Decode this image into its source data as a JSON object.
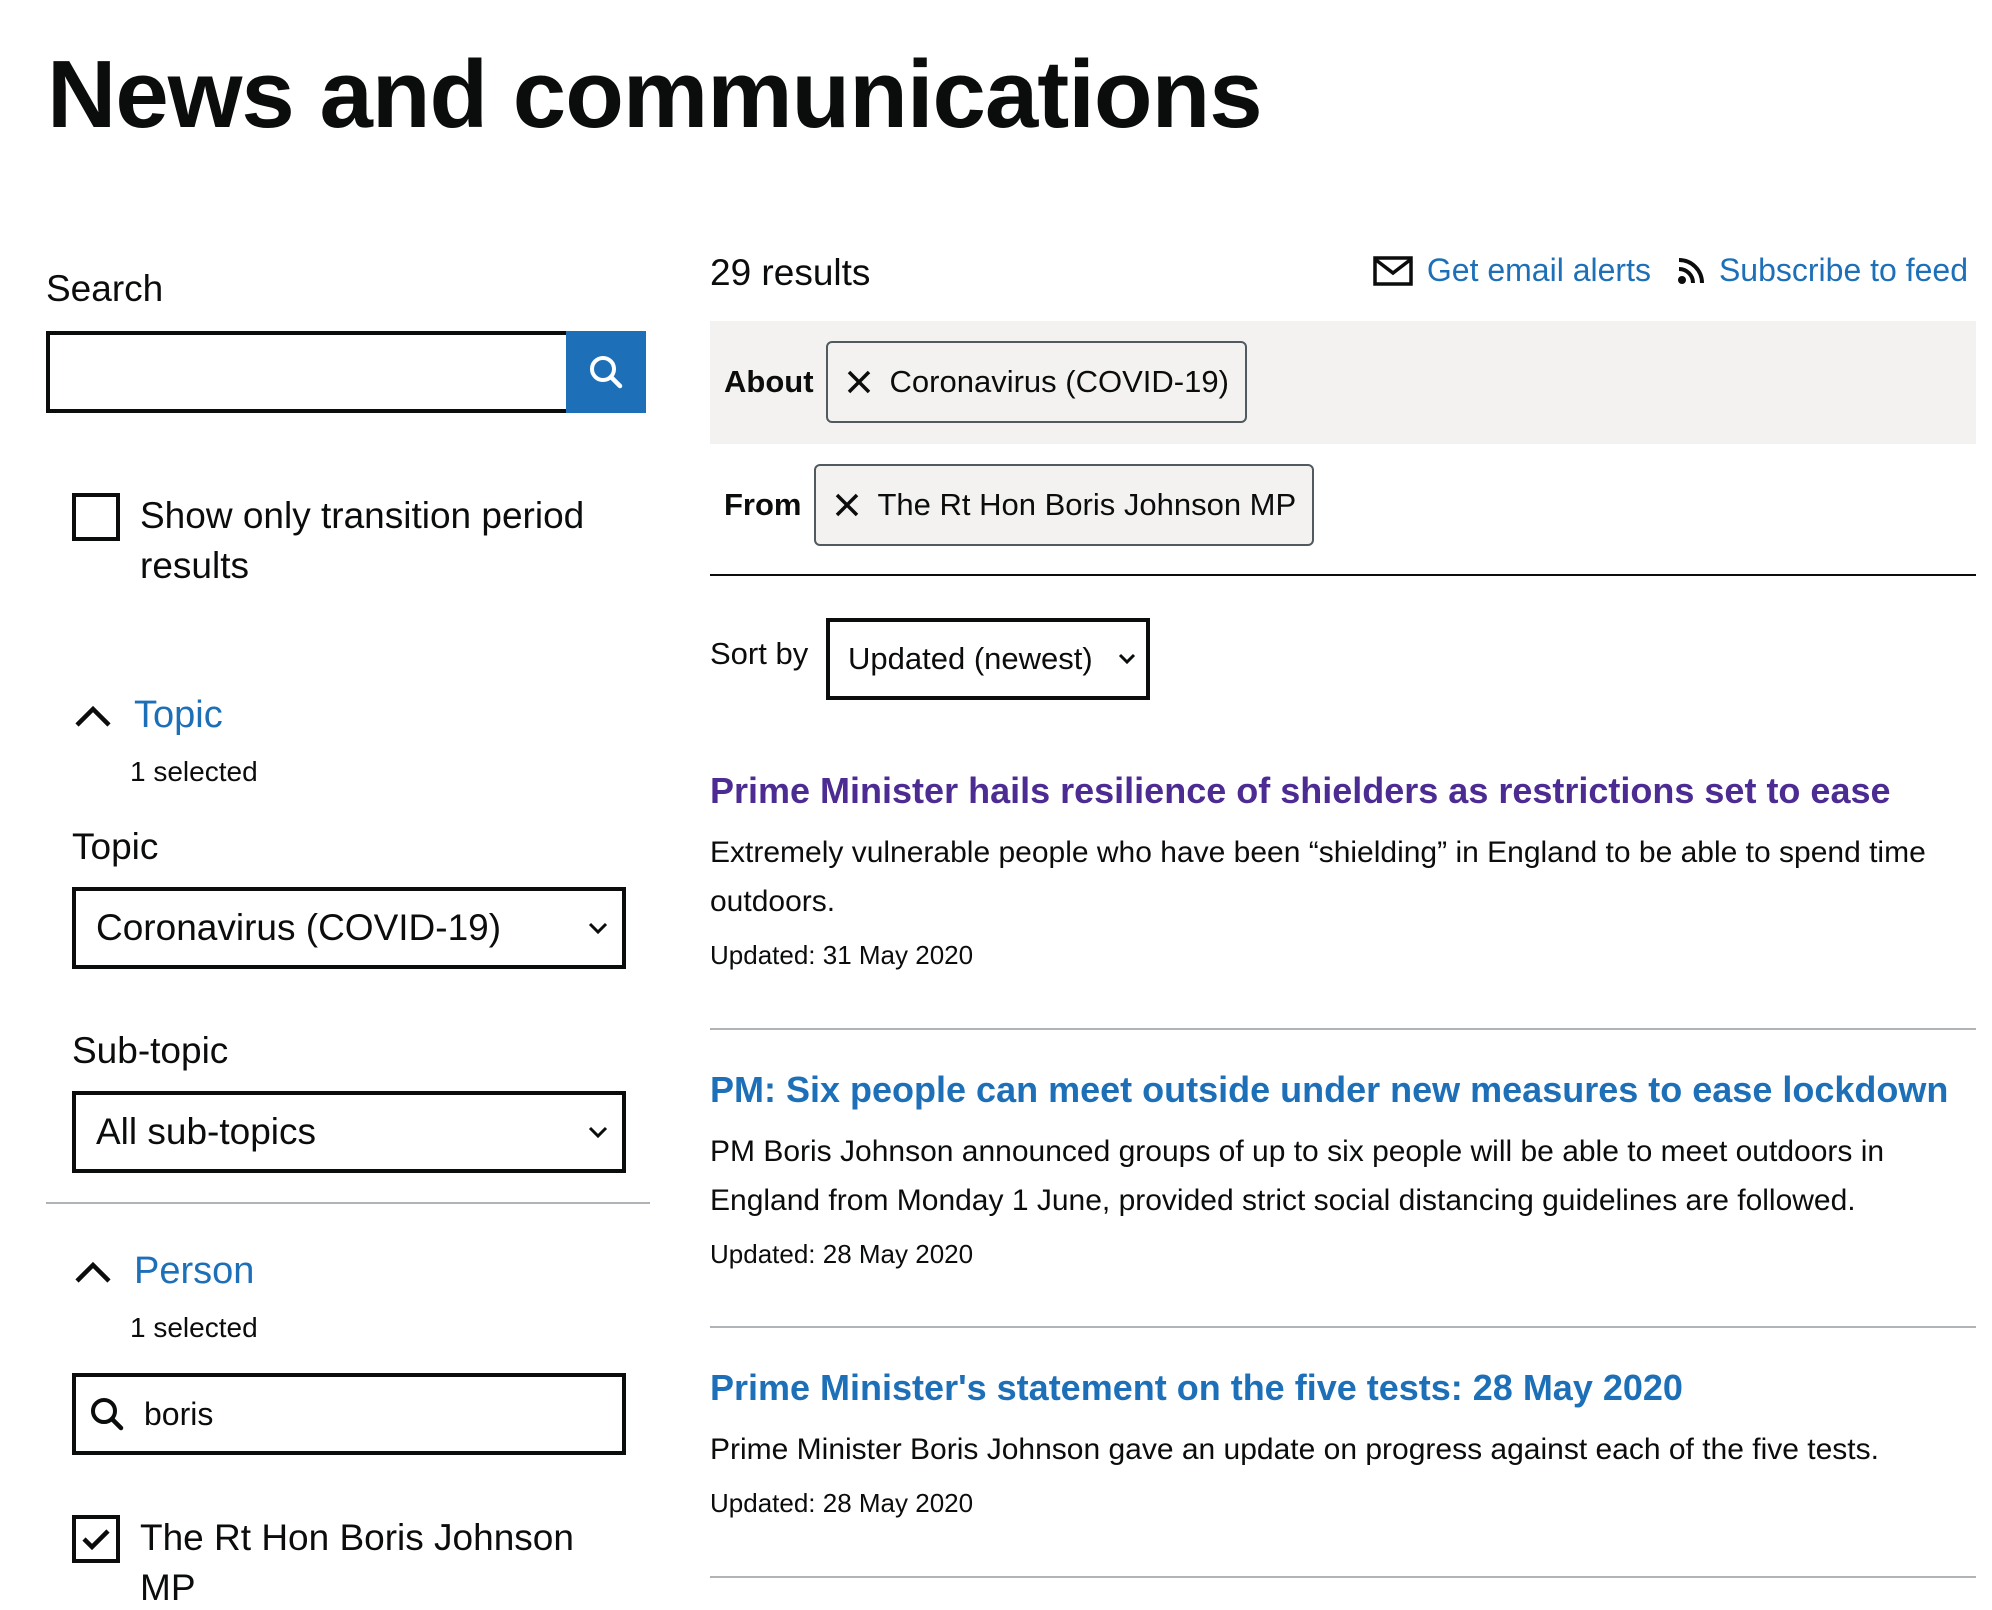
{
  "page": {
    "title": "News and communications"
  },
  "sidebar": {
    "search_label": "Search",
    "search_value": "",
    "transition_checkbox_label": "Show only transition period results",
    "topic_facet": {
      "heading": "Topic",
      "count": "1 selected",
      "topic_label": "Topic",
      "topic_value": "Coronavirus (COVID-19)",
      "subtopic_label": "Sub-topic",
      "subtopic_value": "All sub-topics"
    },
    "person_facet": {
      "heading": "Person",
      "count": "1 selected",
      "search_value": "boris",
      "option_label": "The Rt Hon Boris Johnson MP",
      "option_checked": true
    }
  },
  "results_header": {
    "count": "29 results",
    "email_alerts": "Get email alerts",
    "subscribe": "Subscribe to feed"
  },
  "active_filters": [
    {
      "key": "About",
      "value": "Coronavirus (COVID-19)"
    },
    {
      "key": "From",
      "value": "The Rt Hon Boris Johnson MP"
    }
  ],
  "sort": {
    "label": "Sort by",
    "value": "Updated (newest)"
  },
  "results": [
    {
      "title": "Prime Minister hails resilience of shielders as restrictions set to ease",
      "description": "Extremely vulnerable people who have been “shielding” in England to be able to spend time outdoors.",
      "meta": "Updated: 31 May 2020",
      "visited": true
    },
    {
      "title": "PM: Six people can meet outside under new measures to ease lockdown",
      "description": "PM Boris Johnson announced groups of up to six people will be able to meet outdoors in England from Monday 1 June, provided strict social distancing guidelines are followed.",
      "meta": "Updated: 28 May 2020",
      "visited": false
    },
    {
      "title": "Prime Minister's statement on the five tests: 28 May 2020",
      "description": "Prime Minister Boris Johnson gave an update on progress against each of the five tests.",
      "meta": "Updated: 28 May 2020",
      "visited": false
    }
  ],
  "colors": {
    "link": "#1d70b8",
    "visited_link": "#4c2c92",
    "text": "#0b0c0c",
    "band": "#f3f2f1"
  },
  "icons": {
    "search": "search-icon",
    "chevron_up": "chevron-up-icon",
    "remove": "close-icon",
    "mail": "mail-icon",
    "rss": "rss-icon",
    "check": "check-icon",
    "chevron_down": "chevron-down-icon"
  }
}
